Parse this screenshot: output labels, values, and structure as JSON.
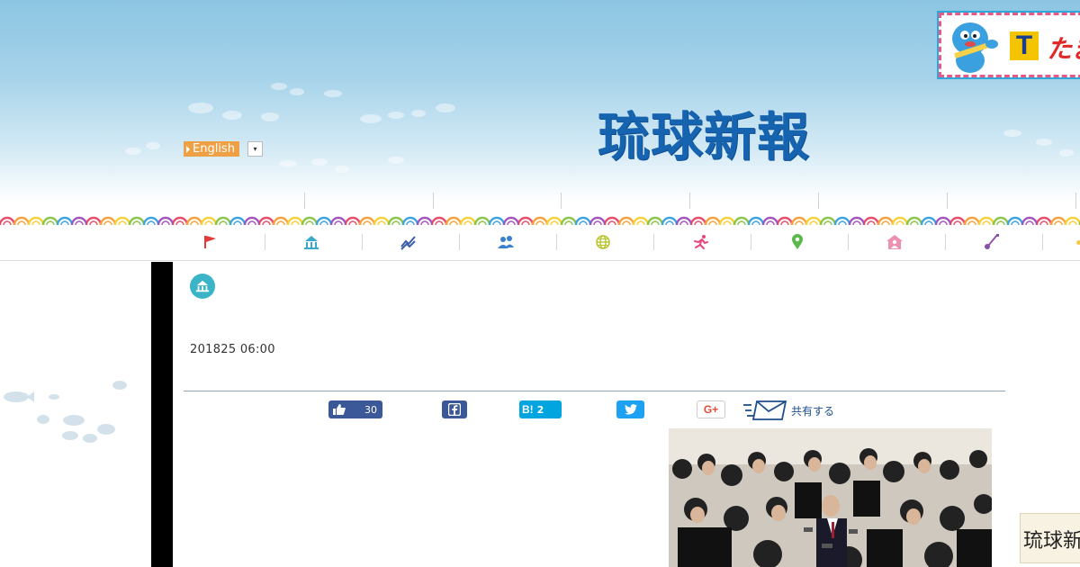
{
  "header": {
    "logo_text": "琉球新報",
    "language_button": "English",
    "language_dropdown_symbol": "▾",
    "ad": {
      "t_logo": "T",
      "text": "たま"
    }
  },
  "nav": {
    "items": [
      {
        "icon": "flag-icon",
        "color": "#e23b3b"
      },
      {
        "icon": "government-building-icon",
        "color": "#39a9c9"
      },
      {
        "icon": "chart-line-icon",
        "color": "#3a5fa8"
      },
      {
        "icon": "people-icon",
        "color": "#3a7fd0"
      },
      {
        "icon": "globe-icon",
        "color": "#b8c632"
      },
      {
        "icon": "runner-icon",
        "color": "#e8457a"
      },
      {
        "icon": "map-pin-icon",
        "color": "#5bb84a"
      },
      {
        "icon": "house-person-icon",
        "color": "#ef8fb0"
      },
      {
        "icon": "sanshin-icon",
        "color": "#8a4fa8"
      }
    ]
  },
  "article": {
    "category_icon": "government-building-icon",
    "category_color": "#3bb4c8",
    "date": "201825 06:00"
  },
  "share": {
    "facebook_like_count": "30",
    "hatena_label": "B!",
    "hatena_count": "2",
    "gplus_label": "G+",
    "mail_share_label": "共有する"
  },
  "corner_badge": {
    "text": "琉球新"
  },
  "colors": {
    "sky_top": "#8cc5e2",
    "logo_blue": "#1663b0",
    "english_button": "#f0a044",
    "facebook": "#3b5998",
    "hatena": "#00a4de",
    "twitter": "#1da1f2",
    "gplus": "#dd4b39"
  }
}
